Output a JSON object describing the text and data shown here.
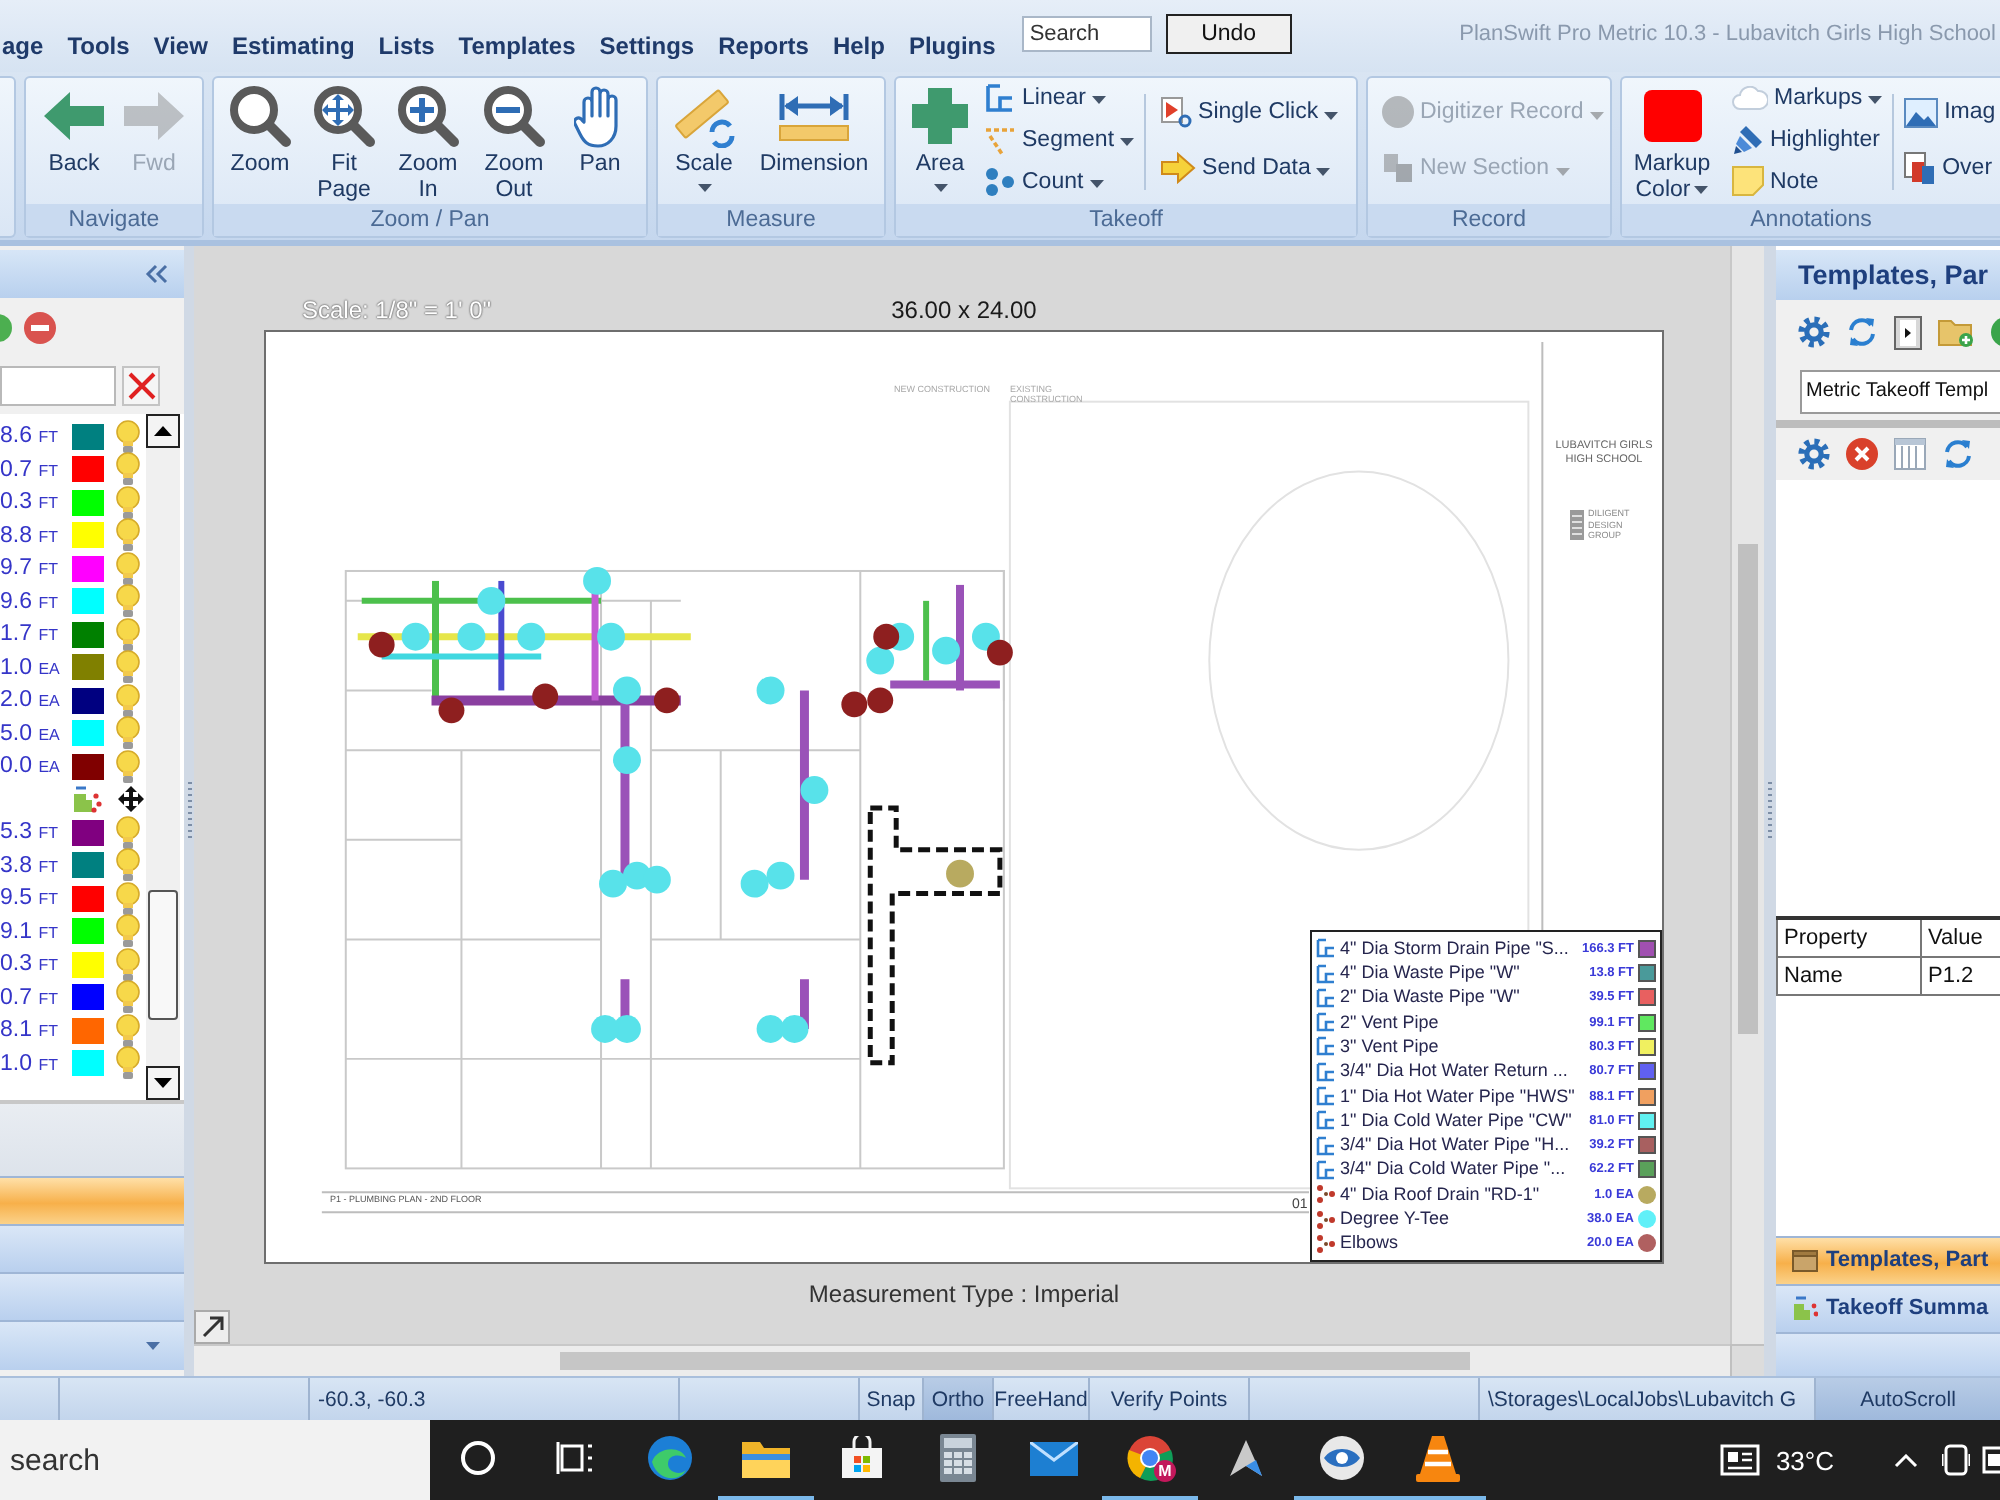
{
  "menu": {
    "items": [
      "age",
      "Tools",
      "View",
      "Estimating",
      "Lists",
      "Templates",
      "Settings",
      "Reports",
      "Help",
      "Plugins"
    ]
  },
  "title_bar": {
    "search": {
      "placeholder": "Search"
    },
    "undo": "Undo",
    "title": "PlanSwift Pro Metric 10.3 - Lubavitch Girls High School"
  },
  "ribbon": {
    "groups": [
      {
        "label": "Navigate",
        "items": [
          {
            "label": "Back",
            "disabled": false
          },
          {
            "label": "Fwd",
            "disabled": true
          }
        ]
      },
      {
        "label": "Zoom / Pan",
        "items": [
          {
            "label": "Zoom",
            "disabled": false
          },
          {
            "label": "Fit Page",
            "disabled": false
          },
          {
            "label": "Zoom In",
            "disabled": false
          },
          {
            "label": "Zoom Out",
            "disabled": false
          },
          {
            "label": "Pan",
            "disabled": false
          }
        ]
      },
      {
        "label": "Measure",
        "items": [
          {
            "label": "Scale",
            "disabled": false
          },
          {
            "label": "Dimension",
            "disabled": false
          }
        ]
      },
      {
        "label": "Takeoff",
        "items": [
          {
            "label": "Area",
            "disabled": false
          },
          {
            "label": "Linear",
            "disabled": false
          },
          {
            "label": "Segment",
            "disabled": false
          },
          {
            "label": "Count",
            "disabled": false
          },
          {
            "label": "Single Click",
            "disabled": false
          },
          {
            "label": "Send Data",
            "disabled": false
          }
        ]
      },
      {
        "label": "Record",
        "items": [
          {
            "label": "Digitizer Record",
            "disabled": true
          },
          {
            "label": "New Section",
            "disabled": true
          }
        ]
      },
      {
        "label": "Annotations",
        "items": [
          {
            "label": "Markup Color",
            "disabled": false
          },
          {
            "label": "Markups",
            "disabled": false
          },
          {
            "label": "Highlighter",
            "disabled": false
          },
          {
            "label": "Note",
            "disabled": false
          },
          {
            "label": "Imag",
            "disabled": false
          },
          {
            "label": "Over",
            "disabled": false
          }
        ]
      }
    ]
  },
  "left_panel": {
    "rows": [
      {
        "kind": "item",
        "quantity": "8.6",
        "unit": "FT",
        "color": "#008080"
      },
      {
        "kind": "item",
        "quantity": "0.7",
        "unit": "FT",
        "color": "#ff0000"
      },
      {
        "kind": "item",
        "quantity": "0.3",
        "unit": "FT",
        "color": "#00ff00"
      },
      {
        "kind": "item",
        "quantity": "8.8",
        "unit": "FT",
        "color": "#ffff00"
      },
      {
        "kind": "item",
        "quantity": "9.7",
        "unit": "FT",
        "color": "#ff00ff"
      },
      {
        "kind": "item",
        "quantity": "9.6",
        "unit": "FT",
        "color": "#00ffff"
      },
      {
        "kind": "item",
        "quantity": "1.7",
        "unit": "FT",
        "color": "#008000"
      },
      {
        "kind": "item",
        "quantity": "1.0",
        "unit": "EA",
        "color": "#808000"
      },
      {
        "kind": "item",
        "quantity": "2.0",
        "unit": "EA",
        "color": "#000080"
      },
      {
        "kind": "item",
        "quantity": "5.0",
        "unit": "EA",
        "color": "#00ffff"
      },
      {
        "kind": "item",
        "quantity": "0.0",
        "unit": "EA",
        "color": "#800000"
      },
      {
        "kind": "group"
      },
      {
        "kind": "item",
        "quantity": "5.3",
        "unit": "FT",
        "color": "#800080"
      },
      {
        "kind": "item",
        "quantity": "3.8",
        "unit": "FT",
        "color": "#008080"
      },
      {
        "kind": "item",
        "quantity": "9.5",
        "unit": "FT",
        "color": "#ff0000"
      },
      {
        "kind": "item",
        "quantity": "9.1",
        "unit": "FT",
        "color": "#00ff00"
      },
      {
        "kind": "item",
        "quantity": "0.3",
        "unit": "FT",
        "color": "#ffff00"
      },
      {
        "kind": "item",
        "quantity": "0.7",
        "unit": "FT",
        "color": "#0000ff"
      },
      {
        "kind": "item",
        "quantity": "8.1",
        "unit": "FT",
        "color": "#ff6600"
      },
      {
        "kind": "item",
        "quantity": "1.0",
        "unit": "FT",
        "color": "#00ffff"
      }
    ],
    "tabs": [
      {
        "selected": true
      },
      {
        "selected": false
      },
      {
        "selected": false
      }
    ]
  },
  "canvas": {
    "scale": "Scale: 1/8\" = 1' 0\"",
    "sheet_size": "36.00 x 24.00",
    "measurement_type": "Measurement Type : Imperial",
    "sheet": {
      "notes": [
        "NEW CONSTRUCTION",
        "EXISTING CONSTRUCTION"
      ],
      "project_title": "LUBAVITCH GIRLS HIGH SCHOOL",
      "firm": "DILIGENT DESIGN GROUP",
      "drawing_title": "P1 - PLUMBING PLAN - 2ND FLOOR",
      "sheet_number": "01"
    },
    "legend": [
      {
        "kind": "linear",
        "name": "4\" Dia Storm Drain Pipe \"S...",
        "quantity": "166.3 FT",
        "color": "#a050b0"
      },
      {
        "kind": "linear",
        "name": "4\" Dia Waste Pipe \"W\"",
        "quantity": "13.8 FT",
        "color": "#4a9a9a"
      },
      {
        "kind": "linear",
        "name": "2\" Dia Waste Pipe \"W\"",
        "quantity": "39.5 FT",
        "color": "#e86060"
      },
      {
        "kind": "linear",
        "name": "2\" Vent Pipe",
        "quantity": "99.1 FT",
        "color": "#60e860"
      },
      {
        "kind": "linear",
        "name": "3\" Vent Pipe",
        "quantity": "80.3 FT",
        "color": "#f0f060"
      },
      {
        "kind": "linear",
        "name": "3/4\" Dia Hot Water Return ...",
        "quantity": "80.7 FT",
        "color": "#6060f0"
      },
      {
        "kind": "linear",
        "name": "1\" Dia Hot Water Pipe \"HWS\"",
        "quantity": "88.1 FT",
        "color": "#f0a060"
      },
      {
        "kind": "linear",
        "name": "1\" Dia Cold Water Pipe \"CW\"",
        "quantity": "81.0 FT",
        "color": "#60f0f0"
      },
      {
        "kind": "linear",
        "name": "3/4\" Dia Hot Water Pipe \"H...",
        "quantity": "39.2 FT",
        "color": "#a86060"
      },
      {
        "kind": "linear",
        "name": "3/4\" Dia Cold Water Pipe \"...",
        "quantity": "62.2 FT",
        "color": "#5aa05a"
      },
      {
        "kind": "count",
        "name": "4\" Dia Roof Drain \"RD-1\"",
        "quantity": "1.0 EA",
        "color": "#b8aa60"
      },
      {
        "kind": "count",
        "name": "Degree Y-Tee",
        "quantity": "38.0 EA",
        "color": "#60f0f8"
      },
      {
        "kind": "count",
        "name": "Elbows",
        "quantity": "20.0 EA",
        "color": "#b06060"
      }
    ]
  },
  "right_panel": {
    "title": "Templates, Par",
    "template": "Metric Takeoff Templ",
    "properties": {
      "columns": [
        "Property",
        "Value"
      ],
      "rows": [
        [
          "Name",
          "P1.2"
        ]
      ]
    },
    "tabs": [
      {
        "label": "Templates, Part",
        "selected": true
      },
      {
        "label": "Takeoff Summa",
        "selected": false
      }
    ]
  },
  "status_bar": {
    "coordinates": "-60.3, -60.3",
    "toggles": [
      {
        "label": "Snap",
        "on": false
      },
      {
        "label": "Ortho",
        "on": true
      },
      {
        "label": "FreeHand",
        "on": false
      },
      {
        "label": "Verify Points",
        "on": false
      }
    ],
    "path": "\\Storages\\LocalJobs\\Lubavitch G",
    "autoscroll": {
      "label": "AutoScroll",
      "on": true
    }
  },
  "taskbar": {
    "search": {
      "placeholder": "search"
    },
    "apps": [
      {
        "running": false
      },
      {
        "running": true
      },
      {
        "running": false
      },
      {
        "running": false
      },
      {
        "running": false
      },
      {
        "running": true,
        "badge": "M"
      },
      {
        "running": false
      },
      {
        "running": true
      },
      {
        "running": true
      }
    ],
    "weather": "33°C"
  }
}
